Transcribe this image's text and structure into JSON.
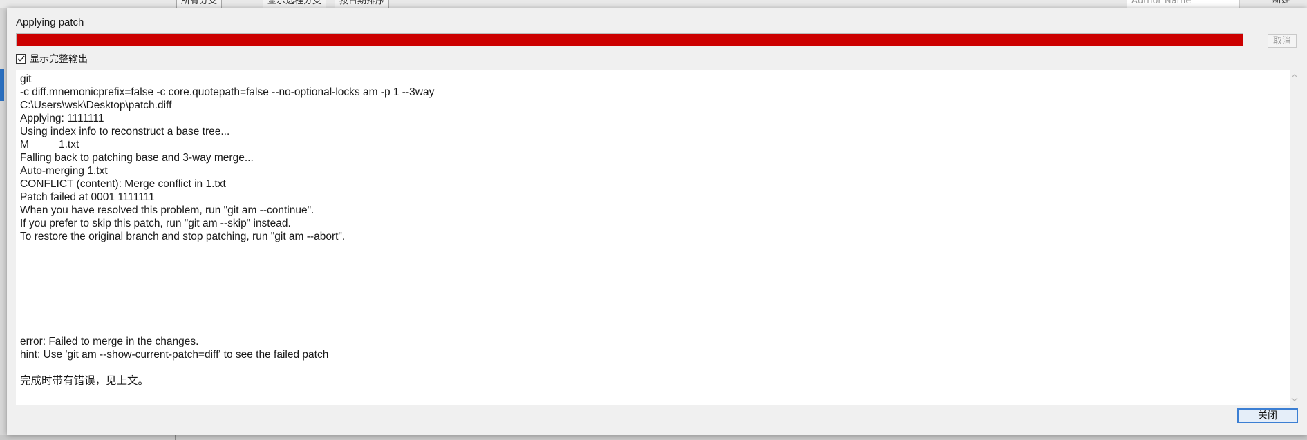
{
  "background": {
    "branch_filter": "所有分支",
    "remote_branches": "显示远程分支",
    "sort_order": "按日期排序",
    "author_search_placeholder": "Author Name",
    "new_branch": "新建"
  },
  "dialog": {
    "title": "Applying patch",
    "progress_percent": 100,
    "progress_color": "#cc0000",
    "cancel_label": "取消",
    "show_full_output_label": "显示完整输出",
    "show_full_output_checked": true,
    "close_label": "关闭"
  },
  "output_lines": [
    "git",
    "-c diff.mnemonicprefix=false -c core.quotepath=false --no-optional-locks am -p 1 --3way",
    "C:\\Users\\wsk\\Desktop\\patch.diff",
    "Applying: 1111111",
    "Using index info to reconstruct a base tree...",
    "M          1.txt",
    "Falling back to patching base and 3-way merge...",
    "Auto-merging 1.txt",
    "CONFLICT (content): Merge conflict in 1.txt",
    "Patch failed at 0001 1111111",
    "When you have resolved this problem, run \"git am --continue\".",
    "If you prefer to skip this patch, run \"git am --skip\" instead.",
    "To restore the original branch and stop patching, run \"git am --abort\".",
    "",
    "",
    "",
    "",
    "",
    "",
    "",
    "error: Failed to merge in the changes.",
    "hint: Use 'git am --show-current-patch=diff' to see the failed patch",
    "",
    "完成时带有错误，见上文。"
  ]
}
